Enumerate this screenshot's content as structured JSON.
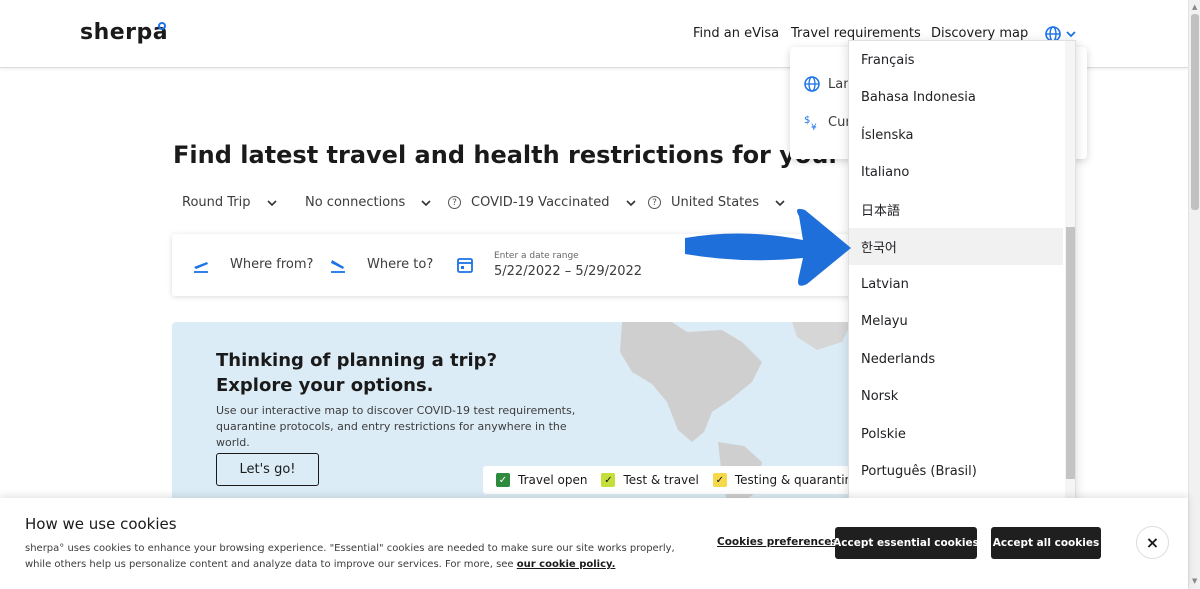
{
  "header": {
    "logo": "sherpa",
    "nav": [
      "Find an eVisa",
      "Travel requirements",
      "Discovery map"
    ],
    "language_icon": "globe-icon"
  },
  "hero": {
    "title": "Find latest travel and health restrictions for your trip.",
    "filters": [
      "Round Trip",
      "No connections",
      "COVID-19 Vaccinated",
      "United States"
    ]
  },
  "search": {
    "from_placeholder": "Where from?",
    "to_placeholder": "Where to?",
    "date_label": "Enter a date range",
    "date_value": "5/22/2022 – 5/29/2022"
  },
  "map_panel": {
    "title_line1": "Thinking of planning a trip?",
    "title_line2": "Explore your options.",
    "description": "Use our interactive map to discover COVID-19 test requirements, quarantine protocols, and entry restrictions for anywhere in the world.",
    "cta": "Let's go!",
    "legend": [
      {
        "label": "Travel open",
        "color": "#2e8b3e"
      },
      {
        "label": "Test & travel",
        "color": "#c5de3a"
      },
      {
        "label": "Testing & quarantine",
        "color": "#f5d94a"
      }
    ]
  },
  "lang_menu": {
    "row1": "Lan",
    "row2": "Cur"
  },
  "languages": {
    "items": [
      "Français",
      "Bahasa Indonesia",
      "Íslenska",
      "Italiano",
      "日本語",
      "한국어",
      "Latvian",
      "Melayu",
      "Nederlands",
      "Norsk",
      "Polskie",
      "Português (Brasil)"
    ],
    "highlighted": "한국어"
  },
  "cookie": {
    "title": "How we use cookies",
    "text": "sherpa° uses cookies to enhance your browsing experience. \"Essential\" cookies are needed to make sure our site works properly, while others help us personalize content and analyze data to improve our services. For more, see",
    "link": "our cookie policy.",
    "preferences": "Cookies preferences",
    "accept_essential": "Accept essential cookies",
    "accept_all": "Accept all cookies",
    "close": "×"
  },
  "colors": {
    "accent": "#1a73e8",
    "arrow": "#1e6fd9",
    "map_bg": "#dcecf6"
  }
}
